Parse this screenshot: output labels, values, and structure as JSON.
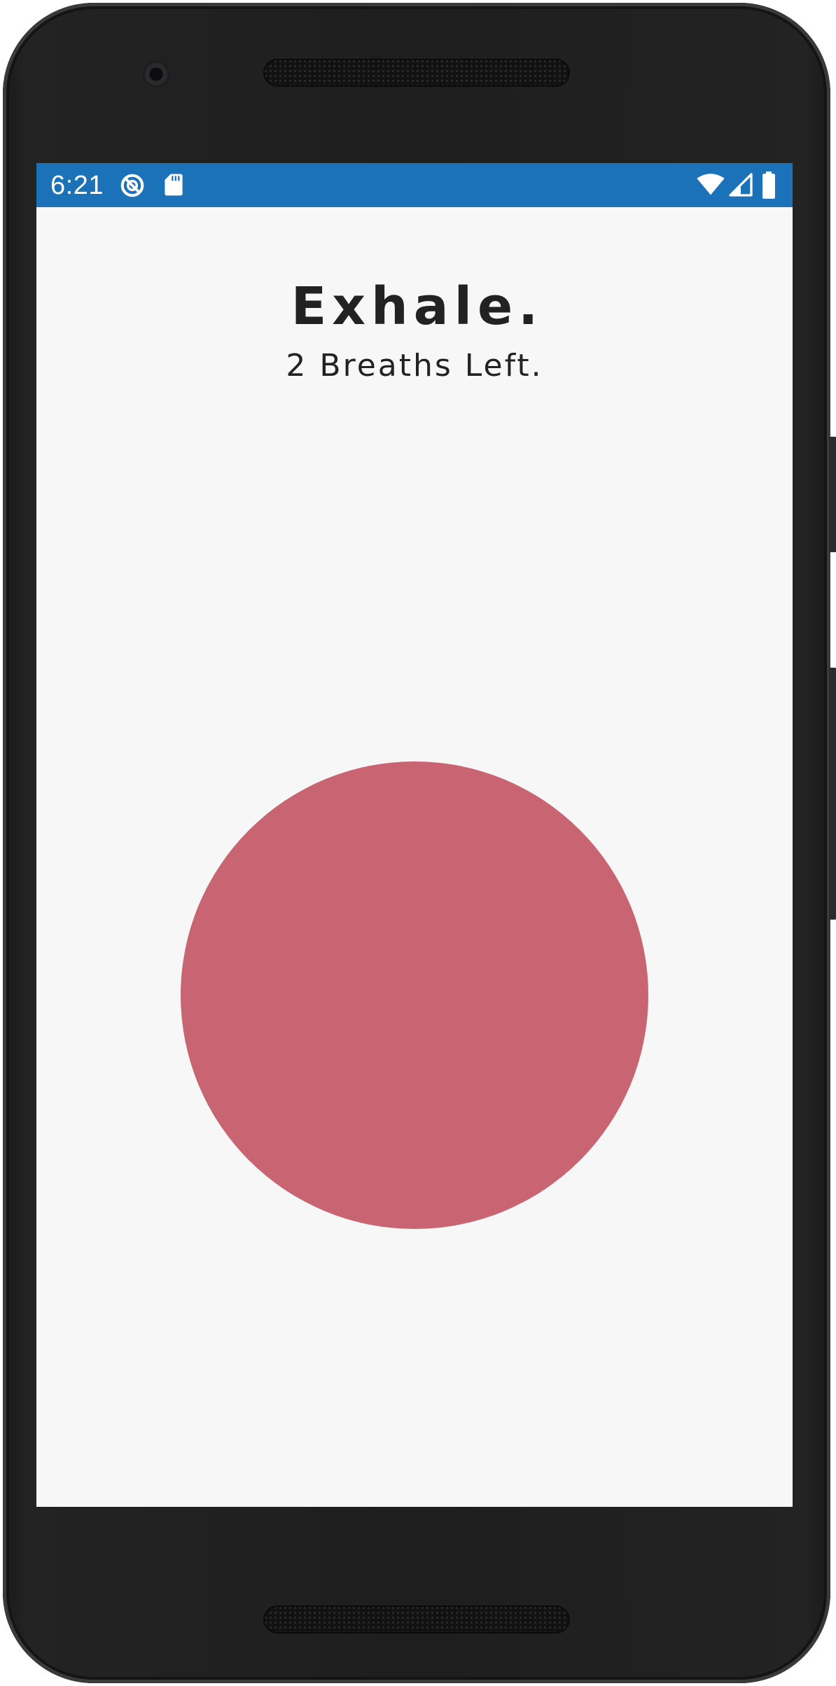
{
  "status_bar": {
    "time": "6:21",
    "background_color": "#1c72b9",
    "icons": [
      "data-saver-icon",
      "sd-card-icon",
      "wifi-icon",
      "signal-icon",
      "battery-icon"
    ]
  },
  "main": {
    "title": "Exhale.",
    "subtitle": "2 Breaths Left.",
    "breath_circle_color": "#c96472"
  }
}
